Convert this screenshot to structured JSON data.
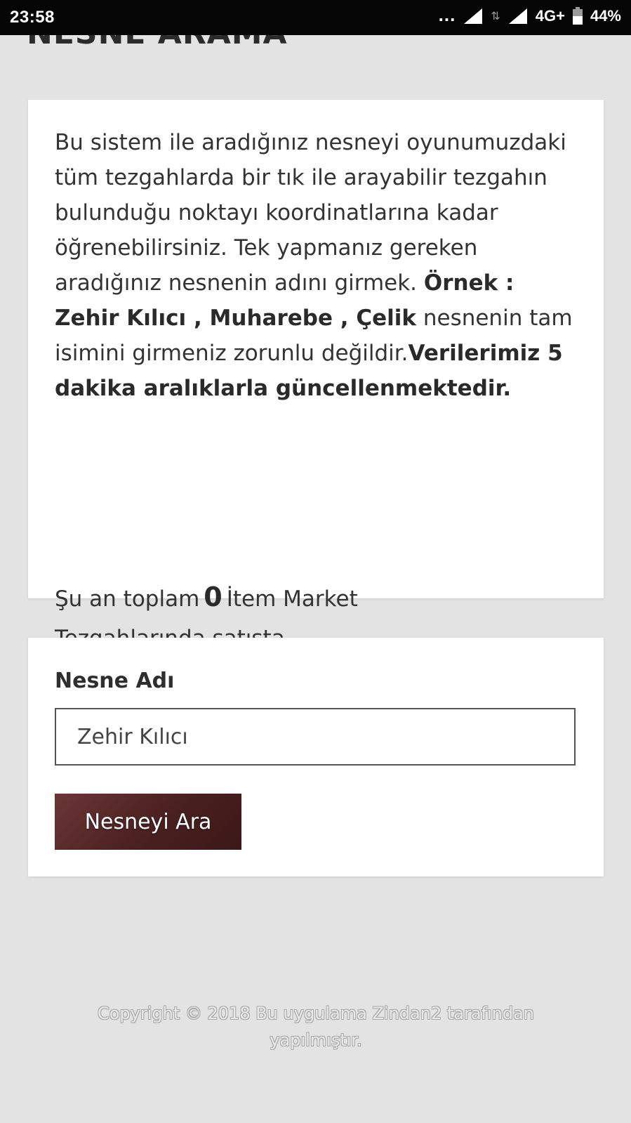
{
  "status_bar": {
    "time": "23:58",
    "dots": "...",
    "network": "4G+",
    "battery": "44%",
    "icons": [
      "signal-icon",
      "transfer-icon",
      "signal-icon",
      "battery-icon"
    ]
  },
  "page": {
    "title": "NESNE ARAMA"
  },
  "info_card": {
    "text_1": "Bu sistem ile aradığınız nesneyi oyunumuzdaki tüm tezgahlarda bir tık ile arayabilir tezgahın bulunduğu noktayı koordinatlarına kadar öğrenebilirsiniz. Tek yapmanız gereken aradığınız nesnenin adını girmek.",
    "example_bold": "Örnek : Zehir Kılıcı , Muharebe , Çelik",
    "text_2": "nesnenin tam isimini girmeniz zorunlu değildir.",
    "update_bold": "Verilerimiz 5 dakika aralıklarla güncellenmektedir.",
    "count_prefix": "Şu an toplam",
    "count_value": "0",
    "count_suffix": "İtem Market Tezgahlarında satışta."
  },
  "search_form": {
    "label": "Nesne Adı",
    "input_value": "Zehir Kılıcı",
    "button_label": "Nesneyi Ara"
  },
  "footer": {
    "text": "Copyright © 2018 Bu uygulama Zindan2 tarafından yapılmıştır."
  },
  "colors": {
    "background": "#e3e3e3",
    "card": "#ffffff",
    "button": "#4a2020",
    "status_bar": "#050505"
  }
}
